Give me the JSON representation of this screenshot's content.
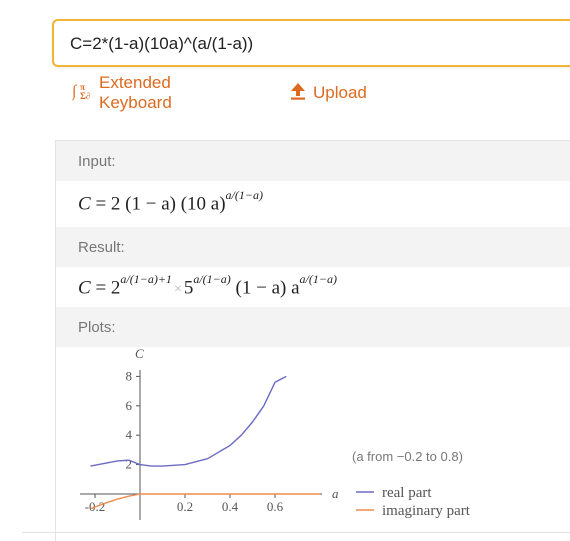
{
  "query": {
    "value": "C=2*(1-a)(10a)^(a/(1-a))"
  },
  "toolbar": {
    "extended_keyboard_label": "Extended Keyboard",
    "upload_label": "Upload",
    "icons": [
      "math-keyboard-icon",
      "upload-icon"
    ],
    "accent_color": "#dd6a1f"
  },
  "pods": {
    "input": {
      "title": "Input:",
      "lhs": "C",
      "eq": "=",
      "rhs_main": "2 (1 − a) (10 a)",
      "rhs_exp": "a/(1−a)"
    },
    "result": {
      "title": "Result:",
      "lhs": "C",
      "eq": "=",
      "base1": "2",
      "exp1": "a/(1−a)+1",
      "times": "×",
      "base2": "5",
      "exp2": "a/(1−a)",
      "mid": "(1 − a) a",
      "exp3": "a/(1−a)"
    },
    "plots": {
      "title": "Plots:",
      "range_note": "(a from −0.2 to 0.8)",
      "ylabel": "C",
      "xlabel": "a",
      "legend": [
        "real part",
        "imaginary part"
      ]
    }
  },
  "chart_data": {
    "type": "line",
    "title": "",
    "xlabel": "a",
    "ylabel": "C",
    "x_ticks": [
      "-0.2",
      "0.2",
      "0.4",
      "0.6"
    ],
    "y_ticks": [
      "2",
      "4",
      "6",
      "8"
    ],
    "xlim": [
      -0.2,
      0.8
    ],
    "ylim": [
      0,
      8.8
    ],
    "series": [
      {
        "name": "real part",
        "color": "#6b6bc4",
        "x": [
          -0.22,
          -0.15,
          -0.1,
          -0.05,
          0.0,
          0.05,
          0.1,
          0.2,
          0.3,
          0.4,
          0.45,
          0.5,
          0.55,
          0.6,
          0.65
        ],
        "y": [
          1.9,
          2.1,
          2.25,
          2.3,
          2.0,
          1.9,
          1.9,
          2.0,
          2.4,
          3.3,
          4.0,
          4.9,
          6.0,
          7.6,
          8.0
        ]
      },
      {
        "name": "imaginary part",
        "color": "#ef8c4e",
        "x": [
          -0.22,
          -0.15,
          -0.1,
          -0.05,
          0.0,
          0.2,
          0.4,
          0.6,
          0.8
        ],
        "y": [
          -1.0,
          -0.6,
          -0.35,
          -0.15,
          0.0,
          0.0,
          0.0,
          0.0,
          0.0
        ]
      }
    ],
    "legend_position": "right"
  }
}
